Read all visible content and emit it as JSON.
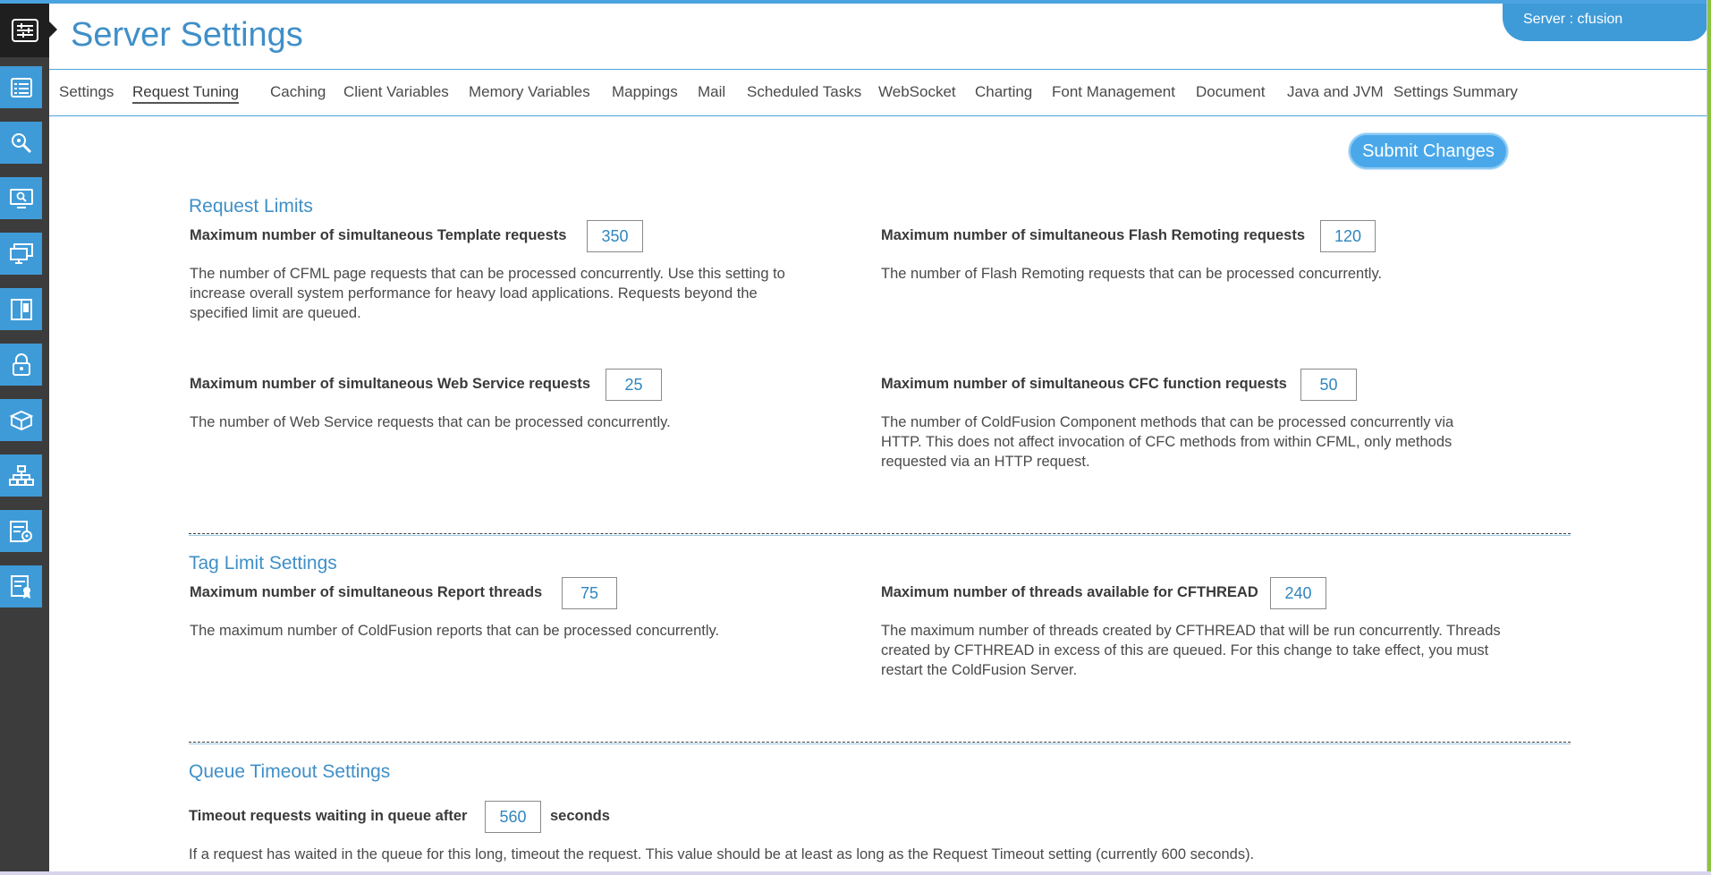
{
  "header": {
    "title": "Server Settings",
    "server_label": "Server : ",
    "server_name": "cfusion"
  },
  "sidebar": {
    "items": [
      {
        "icon": "settings-sliders-icon"
      },
      {
        "icon": "server-list-icon"
      },
      {
        "icon": "search-magnifier-icon"
      },
      {
        "icon": "monitor-search-icon"
      },
      {
        "icon": "desktop-screens-icon"
      },
      {
        "icon": "split-panel-icon"
      },
      {
        "icon": "lock-icon"
      },
      {
        "icon": "package-box-icon"
      },
      {
        "icon": "hierarchy-icon"
      },
      {
        "icon": "database-settings-icon"
      },
      {
        "icon": "certificate-icon"
      }
    ]
  },
  "tabs": [
    {
      "label": "Settings"
    },
    {
      "label": "Request Tuning",
      "active": true
    },
    {
      "label": "Caching"
    },
    {
      "label": "Client Variables"
    },
    {
      "label": "Memory Variables"
    },
    {
      "label": "Mappings"
    },
    {
      "label": "Mail"
    },
    {
      "label": "Scheduled Tasks"
    },
    {
      "label": "WebSocket"
    },
    {
      "label": "Charting"
    },
    {
      "label": "Font Management"
    },
    {
      "label": "Document"
    },
    {
      "label": "Java and JVM"
    },
    {
      "label": "Settings Summary"
    }
  ],
  "actions": {
    "submit_label": "Submit Changes"
  },
  "request_limits": {
    "title": "Request Limits",
    "template": {
      "label": "Maximum number of simultaneous Template requests",
      "value": "350",
      "desc": "The number of CFML page requests that can be processed concurrently. Use this setting to increase overall system performance for heavy load applications. Requests beyond the specified limit are queued."
    },
    "flash": {
      "label": "Maximum number of simultaneous Flash Remoting requests",
      "value": "120",
      "desc": "The number of Flash Remoting requests that can be processed concurrently."
    },
    "webservice": {
      "label": "Maximum number of simultaneous Web Service requests",
      "value": "25",
      "desc": "The number of Web Service requests that can be processed concurrently."
    },
    "cfc": {
      "label": "Maximum number of simultaneous CFC function requests",
      "value": "50",
      "desc": "The number of ColdFusion Component methods that can be processed concurrently via HTTP. This does not affect invocation of CFC methods from within CFML, only methods requested via an HTTP request."
    }
  },
  "tag_limits": {
    "title": "Tag Limit Settings",
    "report": {
      "label": "Maximum number of simultaneous Report threads",
      "value": "75",
      "desc": "The maximum number of ColdFusion reports that can be processed concurrently."
    },
    "cfthread": {
      "label": "Maximum number of threads available for CFTHREAD",
      "value": "240",
      "desc": "The maximum number of threads created by CFTHREAD that will be run concurrently. Threads created by CFTHREAD in excess of this are queued. For this change to take effect, you must restart the ColdFusion Server."
    }
  },
  "queue_timeout": {
    "title": "Queue Timeout Settings",
    "label": "Timeout requests waiting in queue after",
    "value": "560",
    "unit": "seconds",
    "desc": "If a request has waited in the queue for this long, timeout the request. This value should be at least as long as the Request Timeout setting (currently 600 seconds)."
  }
}
